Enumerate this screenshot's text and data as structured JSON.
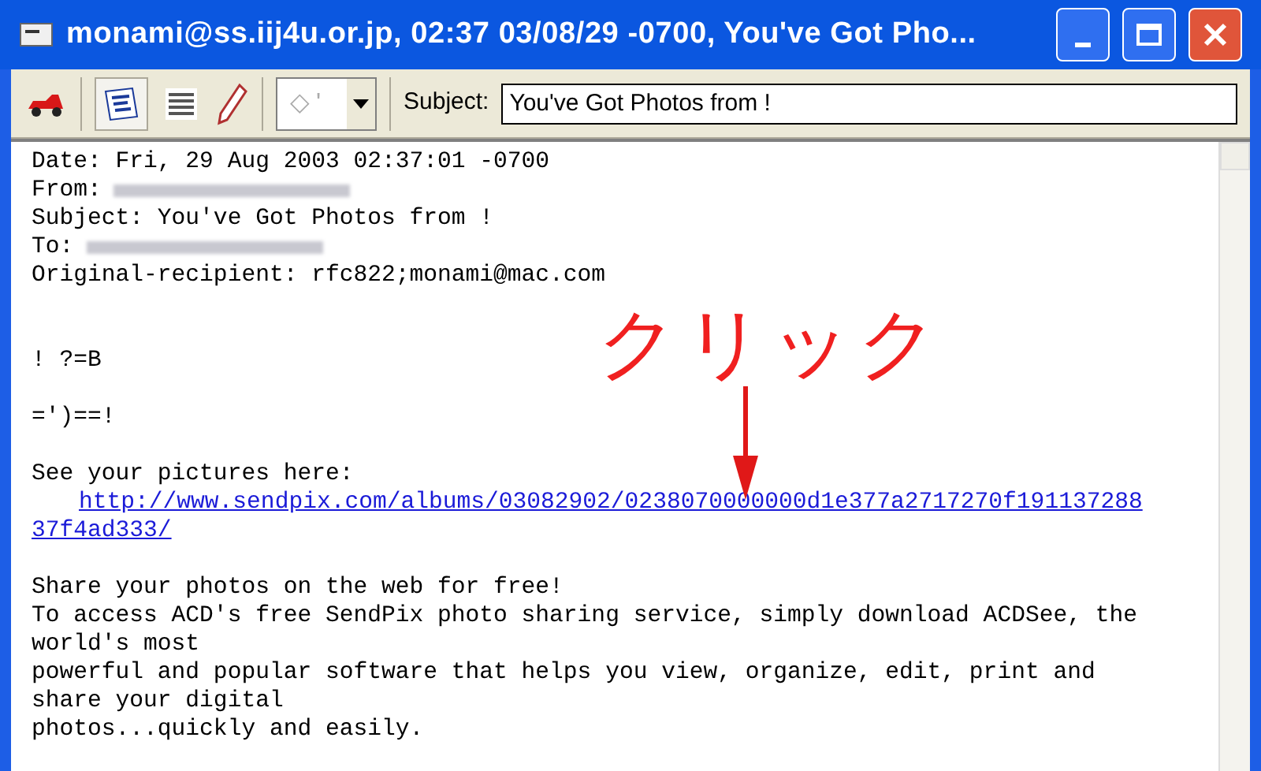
{
  "window": {
    "title": "monami@ss.iij4u.or.jp, 02:37 03/08/29 -0700, You've Got Pho..."
  },
  "toolbar": {
    "combo_value": "◇ '",
    "subject_label": "Subject:",
    "subject_value": "You've Got Photos from !"
  },
  "message": [
    {
      "kind": "text",
      "text": "Date: Fri, 29 Aug 2003 02:37:01 -0700"
    },
    {
      "kind": "redacted",
      "text": "From:"
    },
    {
      "kind": "text",
      "text": "Subject: You've Got Photos from !"
    },
    {
      "kind": "redacted",
      "text": "To:"
    },
    {
      "kind": "text",
      "text": "Original-recipient: rfc822;monami@mac.com"
    },
    {
      "kind": "blank"
    },
    {
      "kind": "blank"
    },
    {
      "kind": "text",
      "text": "! ?=B"
    },
    {
      "kind": "blank"
    },
    {
      "kind": "text",
      "text": "=')==!"
    },
    {
      "kind": "blank"
    },
    {
      "kind": "text",
      "text": "See your pictures here:"
    },
    {
      "kind": "link",
      "indent": true,
      "text": "http://www.sendpix.com/albums/03082902/0238070000000d1e377a2717270f191137288"
    },
    {
      "kind": "link",
      "indent": false,
      "text": "37f4ad333/"
    },
    {
      "kind": "blank"
    },
    {
      "kind": "text",
      "text": "Share your photos on the web for free!"
    },
    {
      "kind": "text",
      "text": "To access ACD's free SendPix photo sharing service, simply download ACDSee, the"
    },
    {
      "kind": "text",
      "text": "world's most"
    },
    {
      "kind": "text",
      "text": "powerful and popular software that helps you view, organize, edit, print and"
    },
    {
      "kind": "text",
      "text": "share your digital"
    },
    {
      "kind": "text",
      "text": "photos...quickly and easily."
    }
  ],
  "annotation": {
    "text": "クリック"
  }
}
